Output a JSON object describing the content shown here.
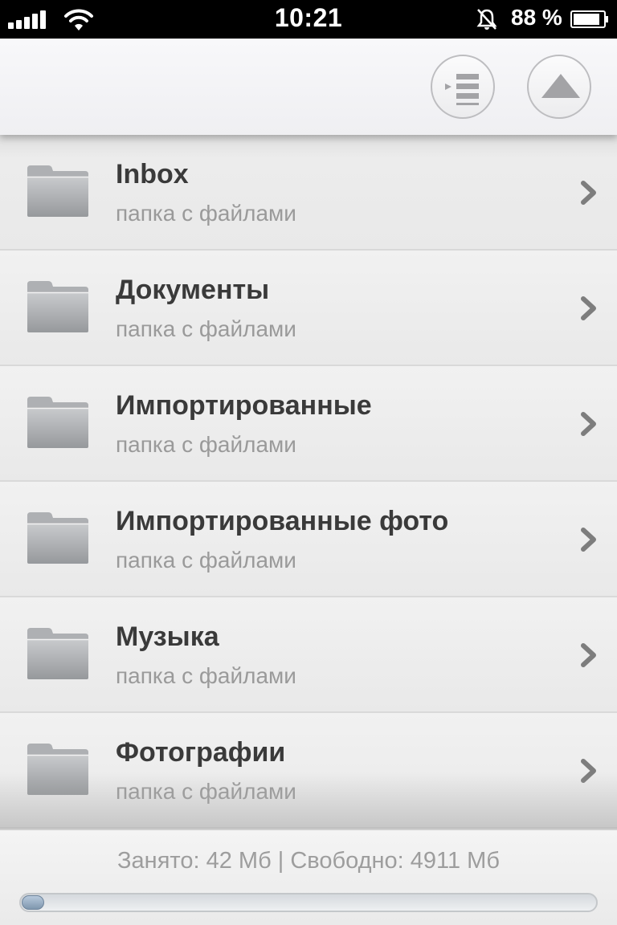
{
  "status_bar": {
    "time": "10:21",
    "battery_percent": "88 %",
    "signal_bars": 5,
    "icons": [
      "signal-icon",
      "wifi-icon",
      "mute-icon",
      "battery-icon"
    ]
  },
  "toolbar": {
    "buttons": [
      "list-menu-icon",
      "eject-up-icon"
    ]
  },
  "folders": [
    {
      "title": "Inbox",
      "subtitle": "папка с файлами"
    },
    {
      "title": "Документы",
      "subtitle": "папка с файлами"
    },
    {
      "title": "Импортированные",
      "subtitle": "папка с файлами"
    },
    {
      "title": "Импортированные фото",
      "subtitle": "папка с файлами"
    },
    {
      "title": "Музыка",
      "subtitle": "папка с файлами"
    },
    {
      "title": "Фотографии",
      "subtitle": "папка с файлами"
    }
  ],
  "footer": {
    "storage_text": "Занято: 42 Мб | Свободно: 4911 Мб",
    "used_fraction": 0.0085
  },
  "colors": {
    "status_bar_bg": "#000000",
    "row_title": "#3a3a3a",
    "row_subtitle": "#9a9a9a",
    "progress_fill": "#7f97ae"
  }
}
